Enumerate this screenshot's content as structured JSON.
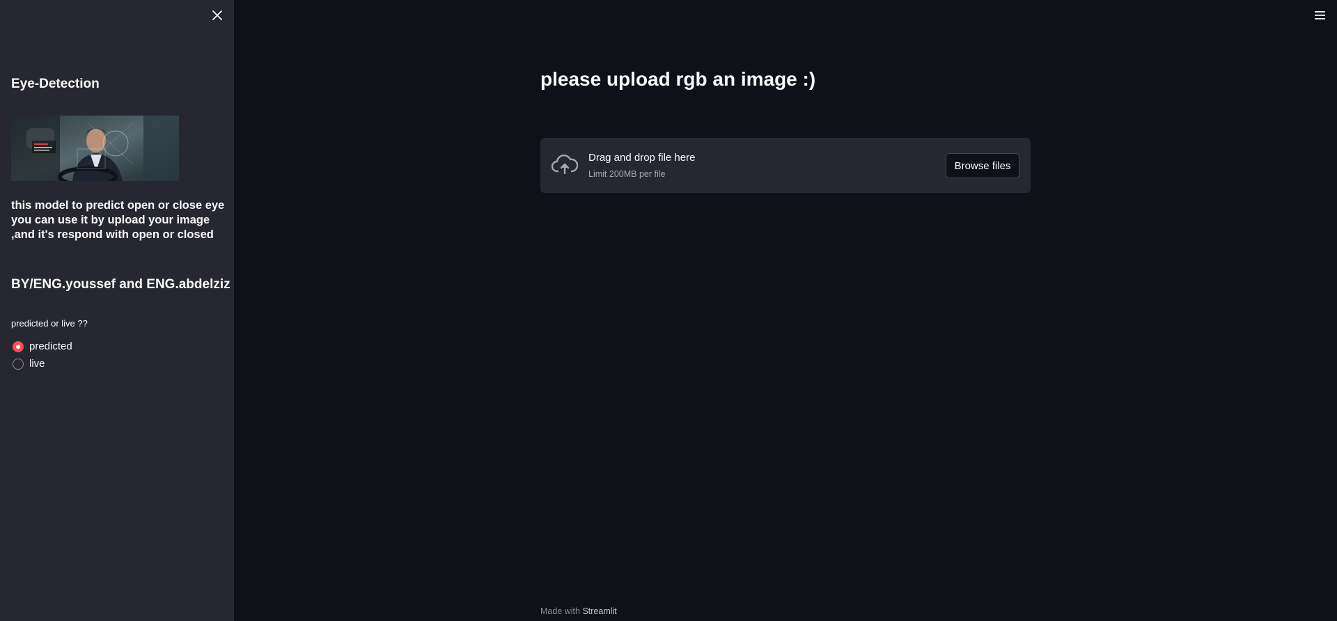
{
  "sidebar": {
    "close_icon": "close-icon",
    "title": "Eye-Detection",
    "image_alt": "driver-in-car-image",
    "description_lines": [
      "this model to predict open or close eye",
      "you can use it by upload your image",
      ",and it's respond with open or closed"
    ],
    "author": "BY/ENG.youssef and ENG.abdelziz",
    "radio": {
      "label": "predicted or live ??",
      "options": [
        "predicted",
        "live"
      ],
      "selected": "predicted"
    }
  },
  "header": {
    "menu_icon": "hamburger-menu-icon"
  },
  "main": {
    "title": "please upload rgb an image :)",
    "uploader": {
      "icon": "cloud-upload-icon",
      "primary_text": "Drag and drop file here",
      "secondary_text": "Limit 200MB per file",
      "button_label": "Browse files"
    }
  },
  "footer": {
    "prefix": "Made with",
    "brand": "Streamlit"
  },
  "colors": {
    "background": "#0e1117",
    "sidebar": "#262730",
    "accent": "#ff4b4b",
    "text": "#fafafa"
  }
}
